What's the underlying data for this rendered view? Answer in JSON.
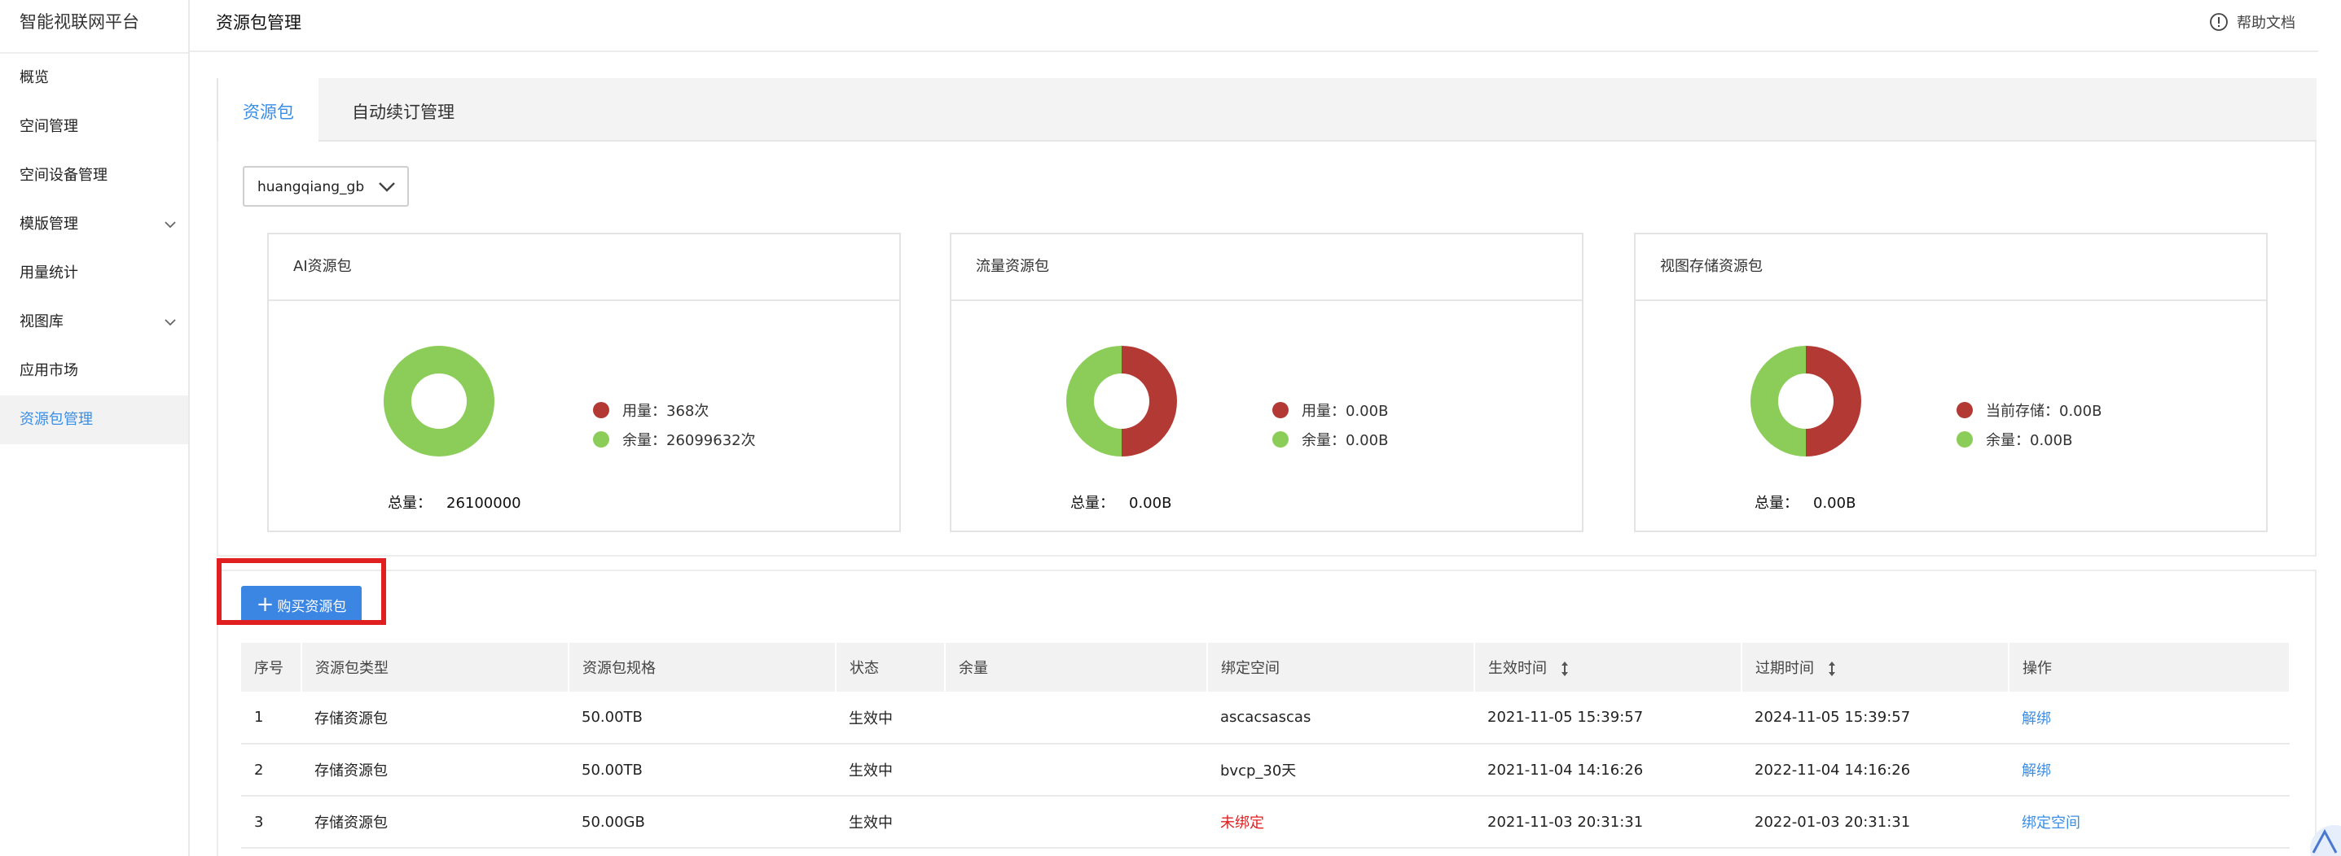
{
  "app": {
    "title": "智能视联网平台"
  },
  "sidebar": {
    "items": [
      {
        "label": "概览"
      },
      {
        "label": "空间管理"
      },
      {
        "label": "空间设备管理"
      },
      {
        "label": "模版管理"
      },
      {
        "label": "用量统计"
      },
      {
        "label": "视图库"
      },
      {
        "label": "应用市场"
      },
      {
        "label": "资源包管理"
      }
    ]
  },
  "header": {
    "title": "资源包管理",
    "help": "帮助文档"
  },
  "tabs": [
    {
      "label": "资源包"
    },
    {
      "label": "自动续订管理"
    }
  ],
  "space_select": {
    "value": "huangqiang_gb"
  },
  "cards": [
    {
      "title": "AI资源包",
      "legend": [
        {
          "label": "用量：368次"
        },
        {
          "label": "余量：26099632次"
        }
      ],
      "total_label": "总量：",
      "total_value": "26100000",
      "chart": {
        "used": 368,
        "remaining": 26099632
      }
    },
    {
      "title": "流量资源包",
      "legend": [
        {
          "label": "用量：0.00B"
        },
        {
          "label": "余量：0.00B"
        }
      ],
      "total_label": "总量：",
      "total_value": "0.00B",
      "chart": {
        "used": 0,
        "remaining": 0
      }
    },
    {
      "title": "视图存储资源包",
      "legend": [
        {
          "label": "当前存储：0.00B"
        },
        {
          "label": "余量：0.00B"
        }
      ],
      "total_label": "总量：",
      "total_value": "0.00B",
      "chart": {
        "used": 0,
        "remaining": 0
      }
    }
  ],
  "colors": {
    "used": "#b33a34",
    "remaining": "#8ccd5a",
    "accent": "#3a8ee6",
    "danger": "#e02020"
  },
  "buy_button": {
    "label": "购买资源包"
  },
  "table": {
    "headers": [
      "序号",
      "资源包类型",
      "资源包规格",
      "状态",
      "余量",
      "绑定空间",
      "生效时间",
      "过期时间",
      "操作"
    ],
    "rows": [
      {
        "no": "1",
        "type": "存储资源包",
        "spec": "50.00TB",
        "status": "生效中",
        "remaining": "",
        "space": "ascacsascas",
        "start": "2021-11-05 15:39:57",
        "end": "2024-11-05 15:39:57",
        "action": "解绑"
      },
      {
        "no": "2",
        "type": "存储资源包",
        "spec": "50.00TB",
        "status": "生效中",
        "remaining": "",
        "space": "bvcp_30天",
        "start": "2021-11-04 14:16:26",
        "end": "2022-11-04 14:16:26",
        "action": "解绑"
      },
      {
        "no": "3",
        "type": "存储资源包",
        "spec": "50.00GB",
        "status": "生效中",
        "remaining": "",
        "space": "未绑定",
        "start": "2021-11-03 20:31:31",
        "end": "2022-01-03 20:31:31",
        "action": "绑定空间"
      }
    ]
  }
}
